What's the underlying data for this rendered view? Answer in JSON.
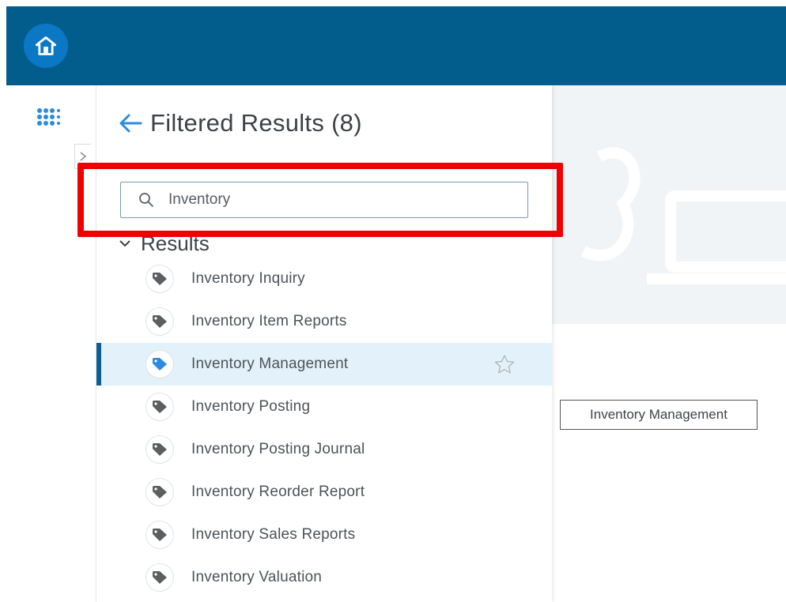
{
  "topbar": {
    "home_icon": "home-icon"
  },
  "rail": {
    "apps_icon": "apps-grid-icon",
    "collapse_icon": "chevron-right-icon"
  },
  "panel": {
    "back_icon": "arrow-left-icon",
    "title": "Filtered Results (8)",
    "search": {
      "value": "Inventory",
      "icon": "search-icon"
    },
    "results": {
      "label": "Results",
      "items": [
        {
          "label": "Inventory Inquiry"
        },
        {
          "label": "Inventory Item Reports"
        },
        {
          "label": "Inventory Management"
        },
        {
          "label": "Inventory Posting"
        },
        {
          "label": "Inventory Posting Journal"
        },
        {
          "label": "Inventory Reorder Report"
        },
        {
          "label": "Inventory Sales Reports"
        },
        {
          "label": "Inventory Valuation"
        }
      ],
      "active_index": 2
    }
  },
  "tooltip": {
    "text": "Inventory Management"
  },
  "colors": {
    "topbar": "#025d8c",
    "home_button": "#0b78c6",
    "accent_blue": "#2b8be0",
    "highlight_frame": "#f00000",
    "active_row": "#e3f1fa",
    "tag_default": "#5a5f64"
  }
}
